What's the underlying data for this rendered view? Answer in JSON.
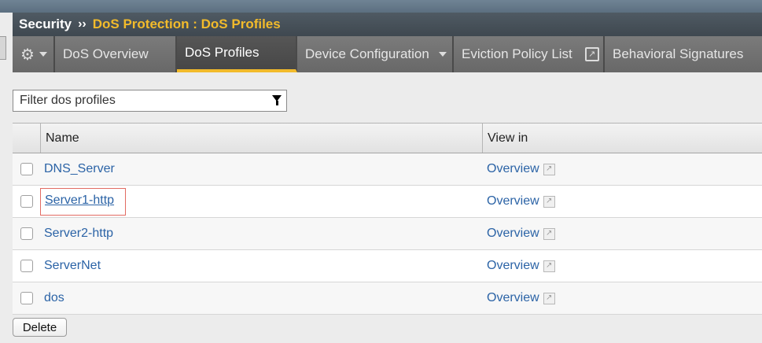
{
  "breadcrumb": {
    "root": "Security",
    "separator": "››",
    "section": "DoS Protection : DoS Profiles"
  },
  "tabs": [
    {
      "label": "DoS Overview",
      "active": false
    },
    {
      "label": "DoS Profiles",
      "active": true
    },
    {
      "label": "Device Configuration",
      "active": false,
      "dropdown": true
    },
    {
      "label": "Eviction Policy List",
      "active": false,
      "external": true
    },
    {
      "label": "Behavioral Signatures",
      "active": false
    }
  ],
  "filter": {
    "placeholder": "Filter dos profiles"
  },
  "table": {
    "columns": [
      "Name",
      "View in"
    ],
    "rows": [
      {
        "name": "DNS_Server",
        "view": "Overview"
      },
      {
        "name": "Server1-http",
        "view": "Overview",
        "highlighted": true
      },
      {
        "name": "Server2-http",
        "view": "Overview"
      },
      {
        "name": "ServerNet",
        "view": "Overview"
      },
      {
        "name": "dos",
        "view": "Overview"
      }
    ]
  },
  "actions": {
    "delete_label": "Delete"
  },
  "colors": {
    "accent": "#f2bb2b",
    "link": "#2b63a6",
    "highlight_border": "#e26b62"
  }
}
